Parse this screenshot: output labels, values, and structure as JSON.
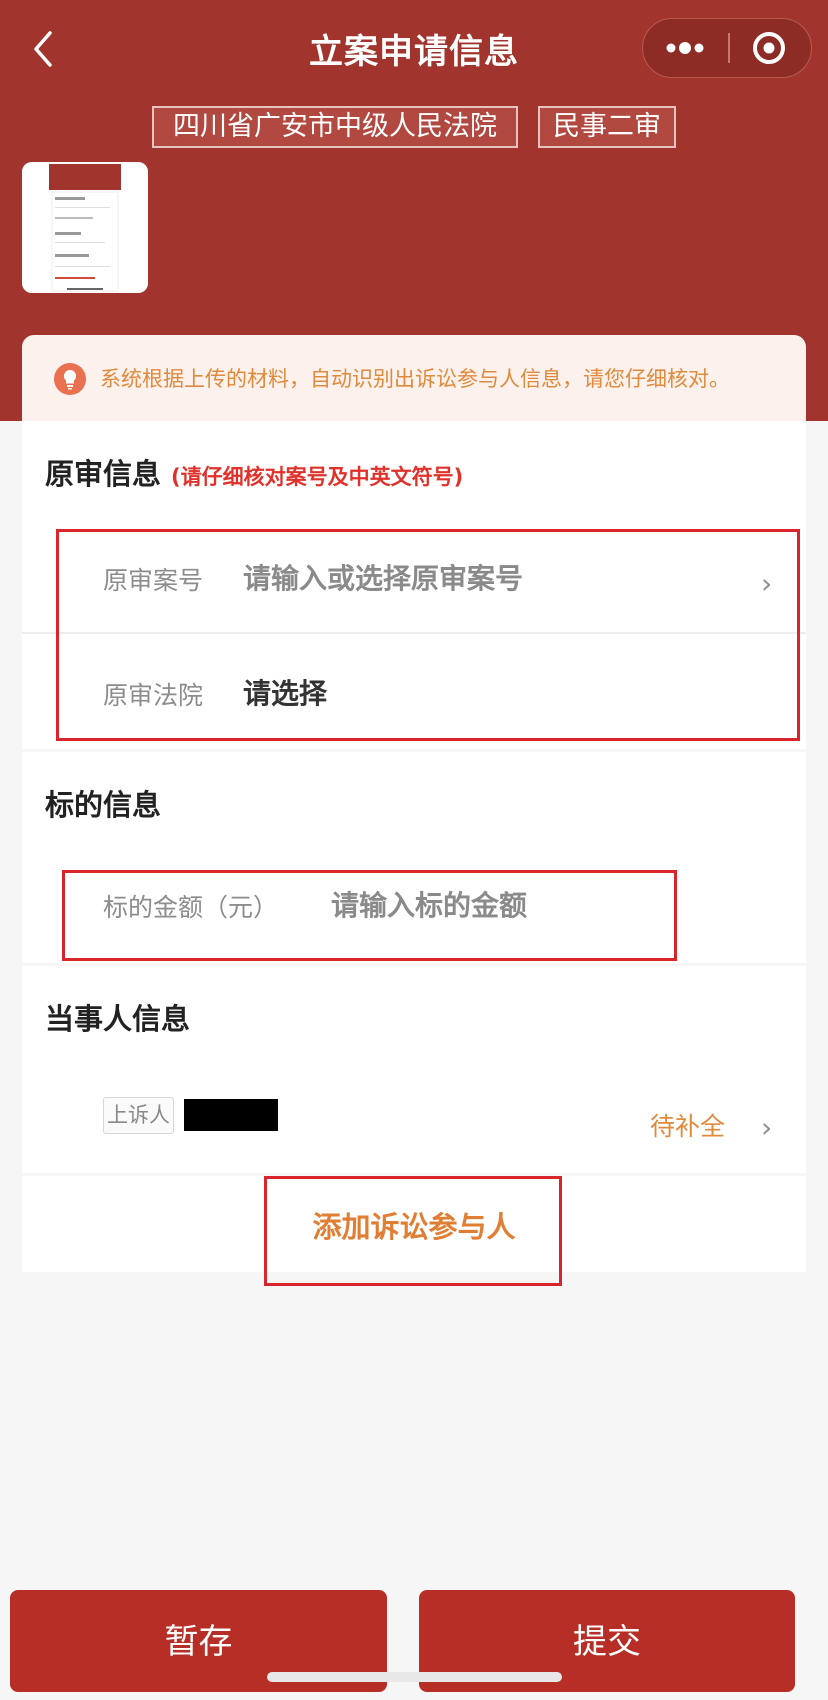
{
  "header": {
    "title": "立案申请信息",
    "court_tag": "四川省广安市中级人民法院",
    "case_type_tag": "民事二审",
    "back_icon": "chevron-left-icon",
    "more_icon": "more-dots-icon",
    "target_icon": "target-icon",
    "bg_color": "#a1352e"
  },
  "notice": {
    "icon": "lightbulb-icon",
    "text": "系统根据上传的材料，自动识别出诉讼参与人信息，请您仔细核对。"
  },
  "original_trial": {
    "title": "原审信息",
    "hint": "(请仔细核对案号及中英文符号)",
    "case_number_label": "原审案号",
    "case_number_placeholder": "请输入或选择原审案号",
    "court_label": "原审法院",
    "court_value": "请选择",
    "chevron": "›"
  },
  "subject": {
    "title": "标的信息",
    "amount_label": "标的金额（元）",
    "amount_placeholder": "请输入标的金额"
  },
  "parties": {
    "title": "当事人信息",
    "role": "上诉人",
    "status": "待补全",
    "chevron": "›",
    "add_label": "添加诉讼参与人"
  },
  "footer": {
    "save_label": "暂存",
    "submit_label": "提交",
    "button_color": "#b72e26"
  }
}
